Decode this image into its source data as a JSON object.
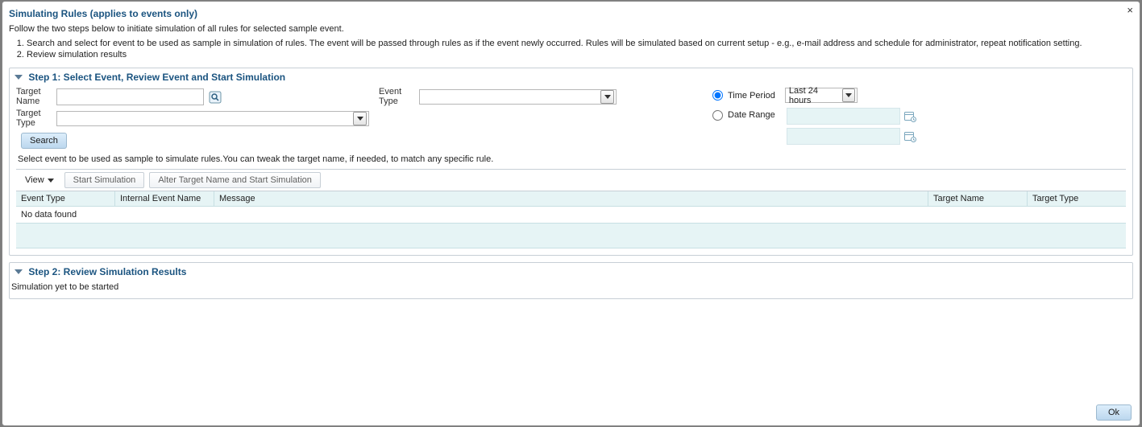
{
  "dialog": {
    "title": "Simulating Rules  (applies to events only)",
    "intro": "Follow the two steps below to initiate simulation of all rules for selected sample event.",
    "steps_list": [
      "Search and select for event to be used as sample in simulation of rules. The event will be passed through rules as if the event newly occurred. Rules will be simulated based on current setup - e.g., e-mail address and schedule for administrator, repeat notification setting.",
      "Review simulation results"
    ],
    "close_label": "×"
  },
  "step1": {
    "header": "Step 1: Select Event, Review Event and Start Simulation",
    "target_name_label_line1": "Target",
    "target_name_label_line2": "Name",
    "target_name_value": "",
    "target_type_label_line1": "Target",
    "target_type_label_line2": "Type",
    "target_type_value": "",
    "event_type_label": "Event Type",
    "event_type_value": "",
    "time_period_label": "Time Period",
    "time_period_value": "Last 24 hours",
    "date_range_label": "Date Range",
    "date_from_value": "",
    "date_to_value": "",
    "search_button": "Search",
    "helper": "Select event to be used as sample to simulate rules.You can tweak the target name, if needed, to match any specific rule.",
    "toolbar": {
      "view_label": "View",
      "start_sim": "Start Simulation",
      "alter_start": "Alter Target Name and Start Simulation"
    },
    "table": {
      "cols": {
        "event_type": "Event Type",
        "internal_event_name": "Internal Event Name",
        "message": "Message",
        "target_name": "Target Name",
        "target_type": "Target Type"
      },
      "empty_text": "No data found"
    }
  },
  "step2": {
    "header": "Step 2: Review Simulation Results",
    "status": "Simulation yet to be started"
  },
  "footer": {
    "ok": "Ok"
  }
}
